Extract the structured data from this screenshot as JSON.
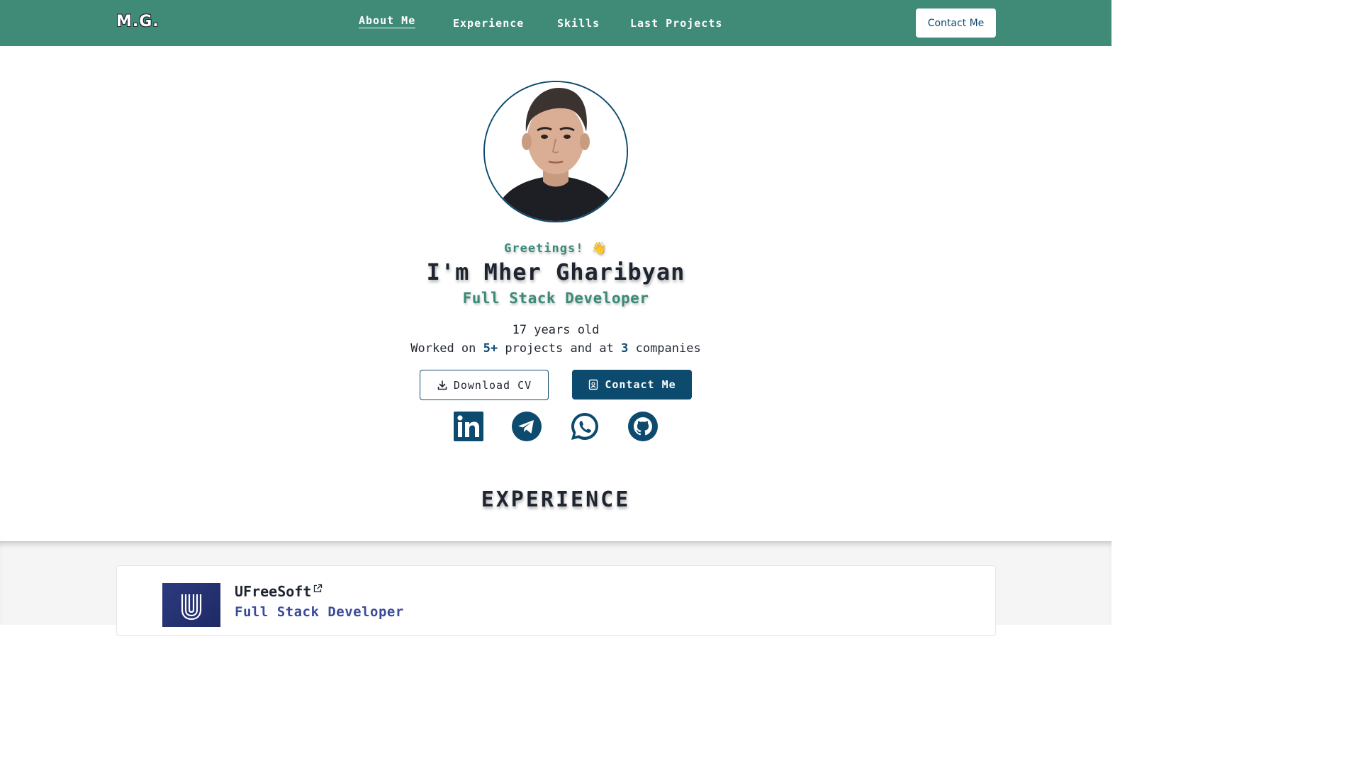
{
  "nav": {
    "logo": "M.G.",
    "links": [
      "About Me",
      "Experience",
      "Skills",
      "Last Projects"
    ],
    "active": "About Me",
    "contact_label": "Contact Me"
  },
  "hero": {
    "greeting": "Greetings! 👋",
    "name": "I'm Mher Gharibyan",
    "role": "Full Stack Developer",
    "age": "17 years old",
    "worked_prefix": "Worked on ",
    "projects_count": "5+",
    "worked_middle": " projects and at ",
    "companies_count": "3",
    "worked_suffix": " companies",
    "download_label": "Download CV",
    "contact_label": "Contact Me",
    "socials": [
      "linkedin-icon",
      "telegram-icon",
      "whatsapp-icon",
      "github-icon"
    ]
  },
  "experience": {
    "title": "EXPERIENCE",
    "items": [
      {
        "company": "UFreeSoft",
        "role": "Full Stack Developer",
        "logo": "ufreesoft-logo"
      }
    ]
  },
  "colors": {
    "nav_bg": "#408a78",
    "accent_green": "#3b8a78",
    "accent_blue": "#0c4a6e",
    "text_dark": "#1f2530",
    "role_blue": "#3a4a9a"
  }
}
